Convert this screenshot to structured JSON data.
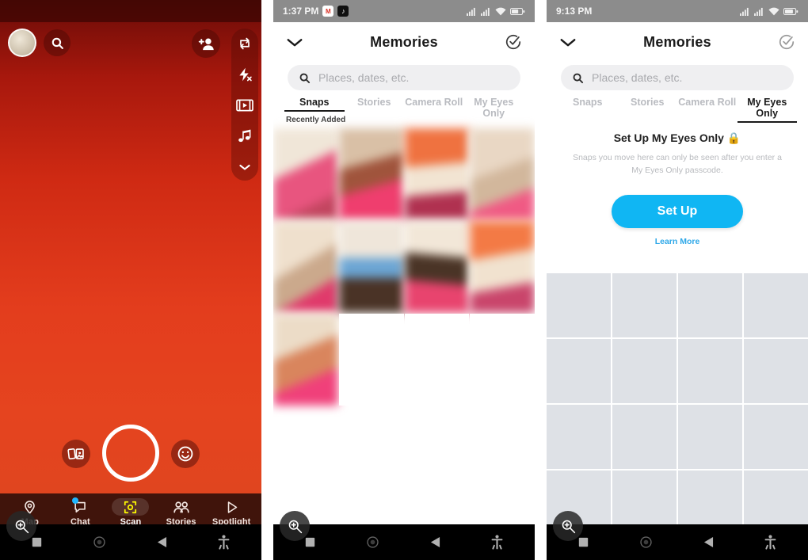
{
  "panels": [
    {
      "id": "camera",
      "type": "snapchat-camera",
      "top_bar": {
        "avatar": "profile-avatar",
        "search_icon": "search-icon",
        "add_friend_icon": "add-friend-icon"
      },
      "tool_rail": [
        {
          "icon": "camera-flip-icon",
          "label": "Flip Camera"
        },
        {
          "icon": "flash-off-icon",
          "label": "Flash Off"
        },
        {
          "icon": "timeline-video-icon",
          "label": "Multi Snap"
        },
        {
          "icon": "music-note-icon",
          "label": "Sounds"
        },
        {
          "icon": "chevron-down-icon",
          "label": "More"
        }
      ],
      "capture": {
        "memories_icon": "memories-cards-icon",
        "shutter": "shutter-button",
        "lens_icon": "lens-smiley-icon"
      },
      "bottom_nav": [
        {
          "label": "Map",
          "icon": "map-pin-icon",
          "active": false,
          "badge": false
        },
        {
          "label": "Chat",
          "icon": "chat-bubble-icon",
          "active": false,
          "badge": true
        },
        {
          "label": "Scan",
          "icon": "scan-icon",
          "active": true,
          "badge": false
        },
        {
          "label": "Stories",
          "icon": "stories-people-icon",
          "active": false,
          "badge": false
        },
        {
          "label": "Spotlight",
          "icon": "spotlight-play-icon",
          "active": false,
          "badge": false
        }
      ],
      "colors": {
        "gradient_top": "#5c0c08",
        "gradient_bottom": "#e5441f",
        "accent": "#FFFC00"
      }
    },
    {
      "id": "memories-snaps",
      "type": "memories",
      "status_bar": {
        "time": "1:37 PM",
        "icons": [
          "gmail-icon",
          "tiktok-icon",
          "signal-icon",
          "signal-icon",
          "wifi-icon",
          "battery-icon"
        ],
        "gmail_glyph": "M",
        "tiktok_glyph": "♪"
      },
      "header": {
        "back_icon": "chevron-down-icon",
        "title": "Memories",
        "select_icon": "circle-check-icon"
      },
      "search": {
        "icon": "search-icon",
        "placeholder": "Places, dates, etc.",
        "value": ""
      },
      "tabs": [
        {
          "label": "Snaps",
          "active": true
        },
        {
          "label": "Stories",
          "active": false
        },
        {
          "label": "Camera Roll",
          "active": false
        },
        {
          "label": "My Eyes Only",
          "active": false
        }
      ],
      "section_label": "Recently Added",
      "grid": {
        "columns": 4,
        "rows": 3,
        "thumbnails": [
          {
            "id": 1,
            "palette": [
              "#f0e6d8",
              "#e8557f",
              "#c2455f"
            ],
            "filled": true
          },
          {
            "id": 2,
            "palette": [
              "#d9c0a6",
              "#ef3e6e",
              "#a0543c"
            ],
            "filled": true
          },
          {
            "id": 3,
            "palette": [
              "#ef7240",
              "#f2e4d2",
              "#b03150"
            ],
            "filled": true
          },
          {
            "id": 4,
            "palette": [
              "#e9d7c4",
              "#f05a84",
              "#d2b79c"
            ],
            "filled": true
          },
          {
            "id": 5,
            "palette": [
              "#efe0cd",
              "#e03a6b",
              "#cba98c"
            ],
            "filled": true
          },
          {
            "id": 6,
            "palette": [
              "#efe6da",
              "#6ba5d4",
              "#4a3326"
            ],
            "filled": true
          },
          {
            "id": 7,
            "palette": [
              "#f2e7d8",
              "#4a3426",
              "#e8446e"
            ],
            "filled": true
          },
          {
            "id": 8,
            "palette": [
              "#f37a45",
              "#f1e2cf",
              "#c9456b"
            ],
            "filled": true
          },
          {
            "id": 9,
            "palette": [
              "#ecdcc7",
              "#d9855d",
              "#f0407a"
            ],
            "filled": true
          },
          {
            "id": 10,
            "filled": false
          },
          {
            "id": 11,
            "filled": false
          },
          {
            "id": 12,
            "filled": false
          }
        ]
      }
    },
    {
      "id": "memories-my-eyes-only",
      "type": "memories",
      "status_bar": {
        "time": "9:13 PM",
        "icons": [
          "signal-icon",
          "signal-icon",
          "wifi-icon",
          "battery-icon"
        ]
      },
      "header": {
        "back_icon": "chevron-down-icon",
        "title": "Memories",
        "select_icon": "circle-check-icon"
      },
      "search": {
        "icon": "search-icon",
        "placeholder": "Places, dates, etc.",
        "value": ""
      },
      "tabs": [
        {
          "label": "Snaps",
          "active": false
        },
        {
          "label": "Stories",
          "active": false
        },
        {
          "label": "Camera Roll",
          "active": false
        },
        {
          "label": "My Eyes Only",
          "active": true
        }
      ],
      "my_eyes_only": {
        "title": "Set Up My Eyes Only",
        "lock_glyph": "🔒",
        "description": "Snaps you move here can only be seen after you enter a My Eyes Only passcode.",
        "button_label": "Set Up",
        "link_label": "Learn More",
        "button_color": "#10b6f3",
        "link_color": "#2fa8e8"
      },
      "placeholder_grid": {
        "columns": 4,
        "rows": 4,
        "cell_color": "#dee1e6"
      }
    }
  ],
  "android_nav": {
    "zoom_fab_icon": "magnifier-plus-icon",
    "items": [
      {
        "icon": "recents-square-icon",
        "label": "Recents"
      },
      {
        "icon": "home-circle-icon",
        "label": "Home"
      },
      {
        "icon": "back-triangle-icon",
        "label": "Back"
      },
      {
        "icon": "accessibility-icon",
        "label": "Accessibility"
      }
    ]
  }
}
